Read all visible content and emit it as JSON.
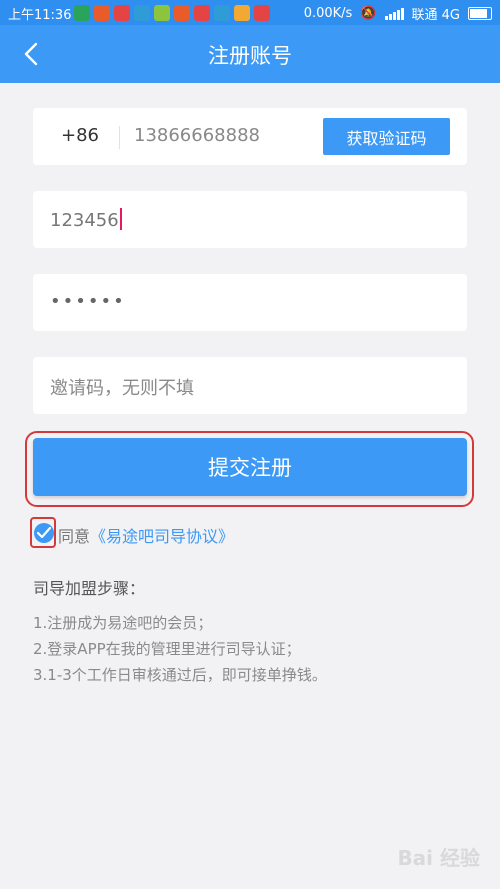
{
  "status": {
    "time": "上午11:36",
    "network_speed": "0.00K/s",
    "carrier": "联通 4G",
    "notif_colors": [
      "#2aa35b",
      "#e95b28",
      "#e54444",
      "#2f9bd7",
      "#8cc43e",
      "#e95b28",
      "#e54444",
      "#2f9bd7",
      "#f1a933",
      "#e54444"
    ]
  },
  "header": {
    "title": "注册账号"
  },
  "form": {
    "country_code": "+86",
    "phone": "13866668888",
    "get_code_label": "获取验证码",
    "password_visible": "123456",
    "password_masked": "••••••",
    "invite_placeholder": "邀请码，无则不填",
    "submit_label": "提交注册"
  },
  "agreement": {
    "prefix": "同意",
    "link": "《易途吧司导协议》"
  },
  "steps": {
    "title": "司导加盟步骤：",
    "items": [
      "1.注册成为易途吧的会员；",
      "2.登录APP在我的管理里进行司导认证；",
      "3.1-3个工作日审核通过后，即可接单挣钱。"
    ]
  },
  "watermark": "Bai 经验",
  "colors": {
    "accent": "#3c99f5",
    "highlight": "#d33b3b"
  }
}
